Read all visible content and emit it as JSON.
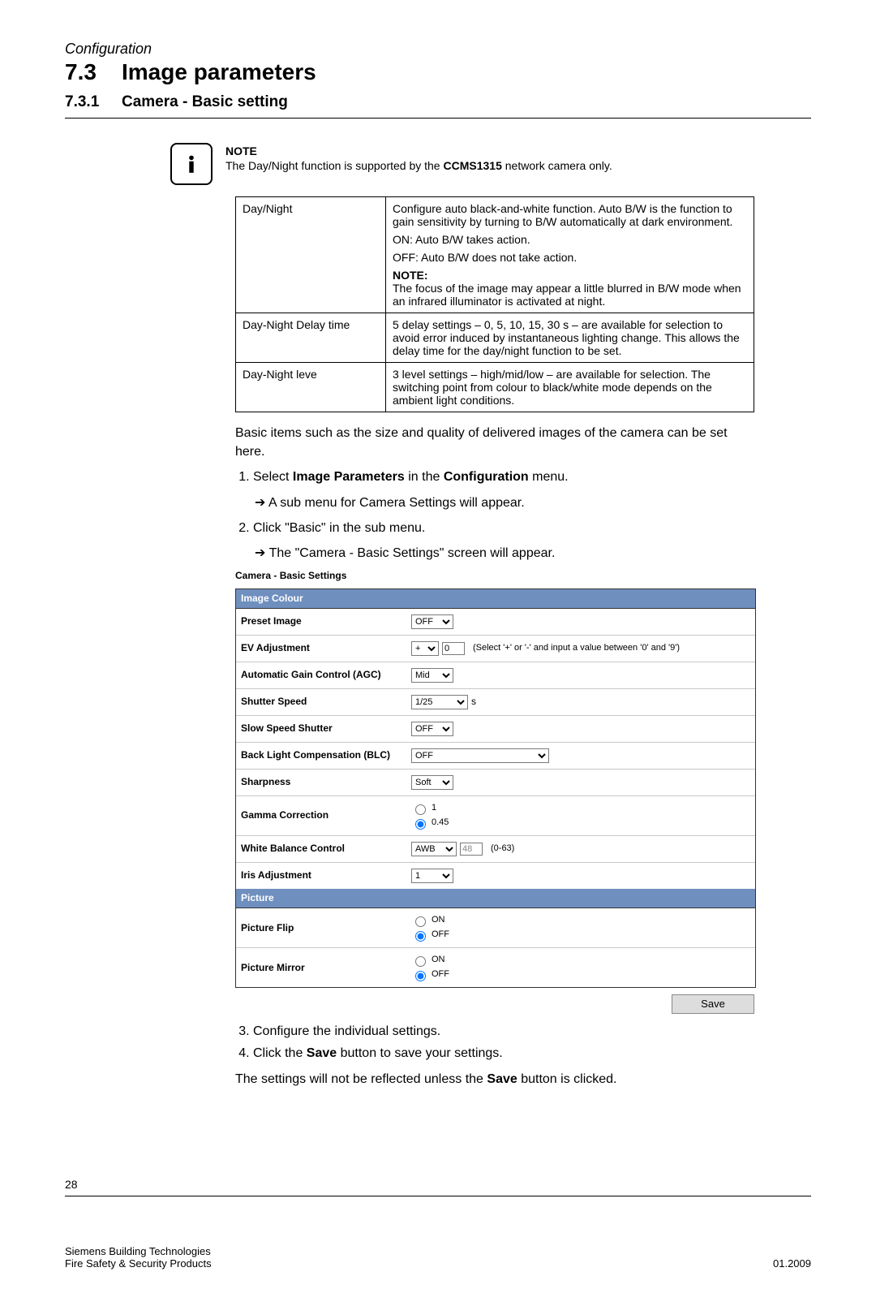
{
  "header": {
    "breadcrumb": "Configuration",
    "section_number": "7.3",
    "section_title": "Image parameters",
    "sub_number": "7.3.1",
    "sub_title": "Camera - Basic setting"
  },
  "note": {
    "label": "NOTE",
    "text_pre": "The Day/Night function is supported by the ",
    "text_bold": "CCMS1315",
    "text_post": " network camera only."
  },
  "desc_table": [
    {
      "name": "Day/Night",
      "desc_lines": [
        "Configure auto black-and-white function. Auto B/W is the function to gain sensitivity by turning to B/W automatically at dark environment.",
        "ON: Auto B/W takes action.",
        "OFF: Auto B/W does not take action."
      ],
      "note_label": "NOTE:",
      "note_text": "The focus of the image may appear a little blurred in B/W mode when an infrared illuminator is activated at night."
    },
    {
      "name": "Day-Night Delay time",
      "desc_lines": [
        "5 delay settings – 0, 5, 10, 15, 30 s – are available for selection to avoid error induced by instantaneous lighting change. This allows the delay time for the day/night function to be set."
      ]
    },
    {
      "name": "Day-Night leve",
      "desc_lines": [
        "3 level settings – high/mid/low – are available for selection. The switching point from colour to black/white mode depends on the ambient light conditions."
      ]
    }
  ],
  "intro_text": "Basic items such as the size and quality of delivered images of the camera can be set here.",
  "steps_a": [
    "Select <b>Image Parameters</b> in the <b>Configuration</b> menu.",
    "Click \"Basic\" in the sub menu."
  ],
  "arrow_a1": "A sub menu for Camera Settings will appear.",
  "arrow_a2": "The \"Camera - Basic Settings\" screen will appear.",
  "panel_title": "Camera - Basic Settings",
  "panel": {
    "image_colour_hdr": "Image Colour",
    "rows_ic": [
      {
        "label": "Preset Image",
        "type": "select",
        "value": "OFF"
      },
      {
        "label": "EV Adjustment",
        "type": "ev",
        "sign": "+",
        "value": "0",
        "hint": "(Select '+' or '-' and input a value between '0' and '9')"
      },
      {
        "label": "Automatic Gain Control (AGC)",
        "type": "select",
        "value": "Mid"
      },
      {
        "label": "Shutter Speed",
        "type": "select_suffix",
        "value": "1/25",
        "suffix": "s"
      },
      {
        "label": "Slow Speed Shutter",
        "type": "select",
        "value": "OFF"
      },
      {
        "label": "Back Light Compensation (BLC)",
        "type": "select_wide",
        "value": "OFF"
      },
      {
        "label": "Sharpness",
        "type": "select",
        "value": "Soft"
      },
      {
        "label": "Gamma Correction",
        "type": "radio",
        "options": [
          "1",
          "0.45"
        ],
        "selected": "0.45"
      },
      {
        "label": "White Balance Control",
        "type": "wb",
        "value": "AWB",
        "num": "48",
        "hint": "(0-63)"
      },
      {
        "label": "Iris Adjustment",
        "type": "select",
        "value": "1"
      }
    ],
    "picture_hdr": "Picture",
    "rows_pic": [
      {
        "label": "Picture Flip",
        "type": "radio",
        "options": [
          "ON",
          "OFF"
        ],
        "selected": "OFF"
      },
      {
        "label": "Picture Mirror",
        "type": "radio",
        "options": [
          "ON",
          "OFF"
        ],
        "selected": "OFF"
      }
    ],
    "save_label": "Save"
  },
  "steps_b": [
    "Configure the individual settings.",
    "Click the <b>Save</b> button to save your settings."
  ],
  "closing_text": "The settings will not be reflected unless the <b>Save</b> button is clicked.",
  "footer": {
    "page_number": "28",
    "left1": "Siemens Building Technologies",
    "left2": "Fire Safety & Security Products",
    "right": "01.2009"
  }
}
